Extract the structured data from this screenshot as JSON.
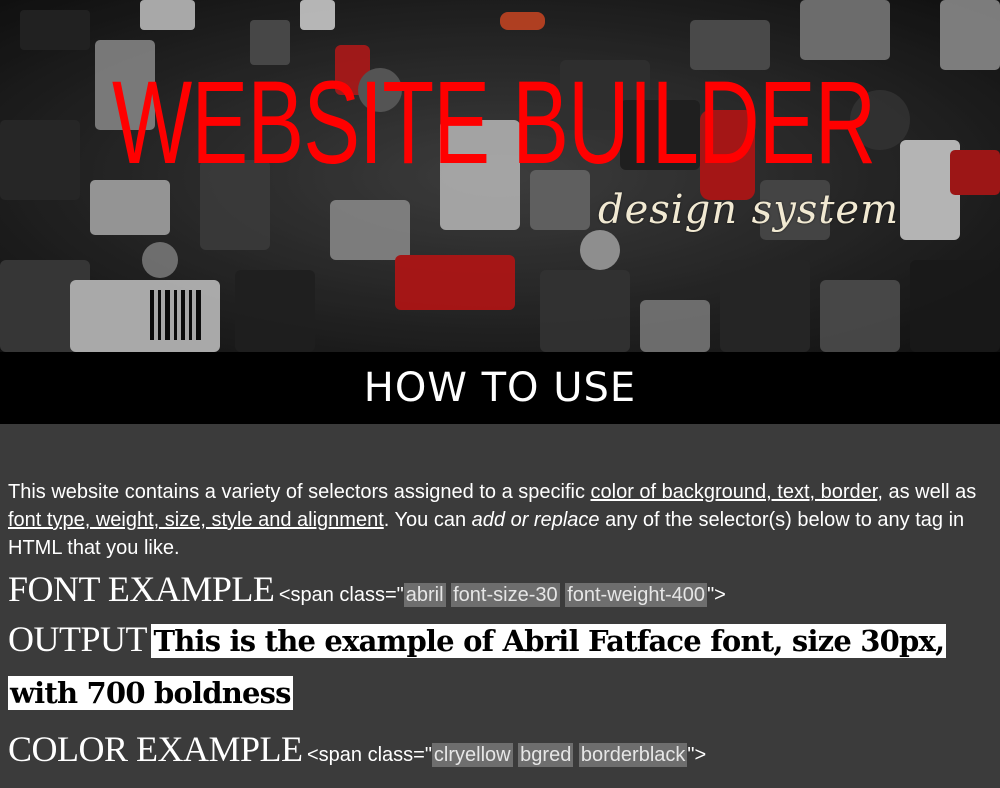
{
  "hero": {
    "title": "WEBSITE BUILDER",
    "subtitle": "design system",
    "background_image": "lego-pieces-photo",
    "title_color": "#ff0000",
    "subtitle_color": "#f1e9d2"
  },
  "banner": {
    "heading": "HOW TO USE"
  },
  "intro": {
    "part1": "This website contains a variety of selectors assigned to a specific ",
    "link1": "color of background, text, border",
    "part2": ", as well as ",
    "link2": "font type, weight, size, style and alignment",
    "part3": ". You can ",
    "emphasis": "add or replace",
    "part4": " any of the selector(s) below to any tag in HTML that you like."
  },
  "font_example": {
    "label": "FONT EXAMPLE",
    "code_open": "<span class=\"",
    "classes": [
      "abril",
      "font-size-30",
      "font-weight-400"
    ],
    "code_close": "\">"
  },
  "output_example": {
    "label": "OUTPUT",
    "text": "This is the example of Abril Fatface font, size 30px, with 700 boldness"
  },
  "color_example": {
    "label": "COLOR EXAMPLE",
    "code_open": "<span class=\"",
    "classes": [
      "clryellow",
      "bgred",
      "borderblack"
    ],
    "code_close": "\">"
  }
}
